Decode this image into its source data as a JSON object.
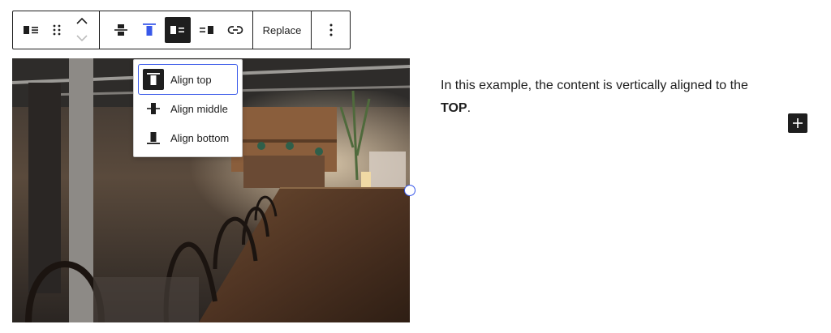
{
  "toolbar": {
    "replace_label": "Replace",
    "active_color": "#3858e9"
  },
  "dropdown": {
    "items": [
      {
        "label": "Align top",
        "icon": "align-top-icon",
        "focused": true
      },
      {
        "label": "Align middle",
        "icon": "align-middle-icon",
        "focused": false
      },
      {
        "label": "Align bottom",
        "icon": "align-bottom-icon",
        "focused": false
      }
    ]
  },
  "content": {
    "text_before": "In this example, the content is vertically aligned to the ",
    "text_strong": "TOP",
    "text_after": "."
  },
  "colors": {
    "focus": "#3858e9",
    "dark": "#1e1e1e"
  }
}
